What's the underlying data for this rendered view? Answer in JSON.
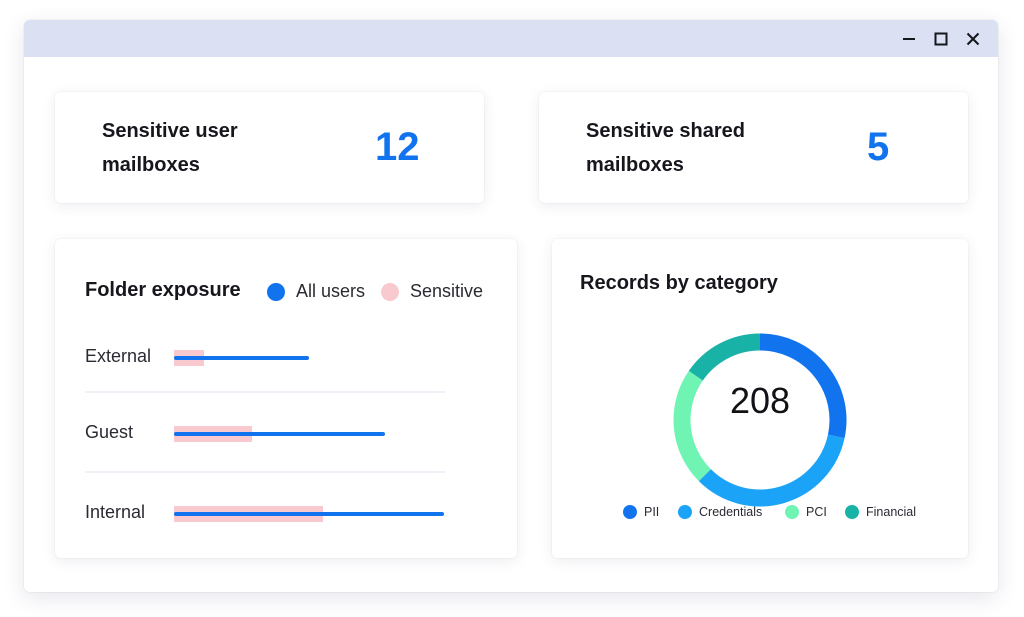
{
  "window": {
    "controls": {
      "minimize_icon": "minimize-icon",
      "maximize_icon": "maximize-icon",
      "close_icon": "close-icon"
    }
  },
  "stats": {
    "user_mailboxes": {
      "label": "Sensitive user mailboxes",
      "value": "12"
    },
    "shared_mailboxes": {
      "label": "Sensitive shared mailboxes",
      "value": "5"
    }
  },
  "folder_exposure": {
    "title": "Folder exposure",
    "legend": [
      {
        "label": "All users",
        "color": "#1174ee"
      },
      {
        "label": "Sensitive",
        "color": "#f8c9ce"
      }
    ],
    "chart_data": {
      "type": "bar",
      "orientation": "horizontal",
      "categories": [
        "External",
        "Guest",
        "Internal"
      ],
      "series": [
        {
          "name": "All users",
          "values": [
            0.5,
            0.78,
            1.0
          ]
        },
        {
          "name": "Sensitive",
          "values": [
            0.11,
            0.29,
            0.55
          ]
        }
      ],
      "xlim": [
        0,
        1
      ],
      "grid": false,
      "legend_placement": "top-right"
    }
  },
  "records_by_category": {
    "title": "Records by category",
    "total": "208",
    "chart_data": {
      "type": "pie",
      "style": "donut",
      "categories": [
        "PII",
        "Credentials",
        "PCI",
        "Financial"
      ],
      "values": [
        59,
        71,
        46,
        32
      ],
      "colors": [
        "#1174ee",
        "#1aa3f7",
        "#6ff4b3",
        "#19b2a7"
      ],
      "legend_placement": "bottom"
    }
  }
}
